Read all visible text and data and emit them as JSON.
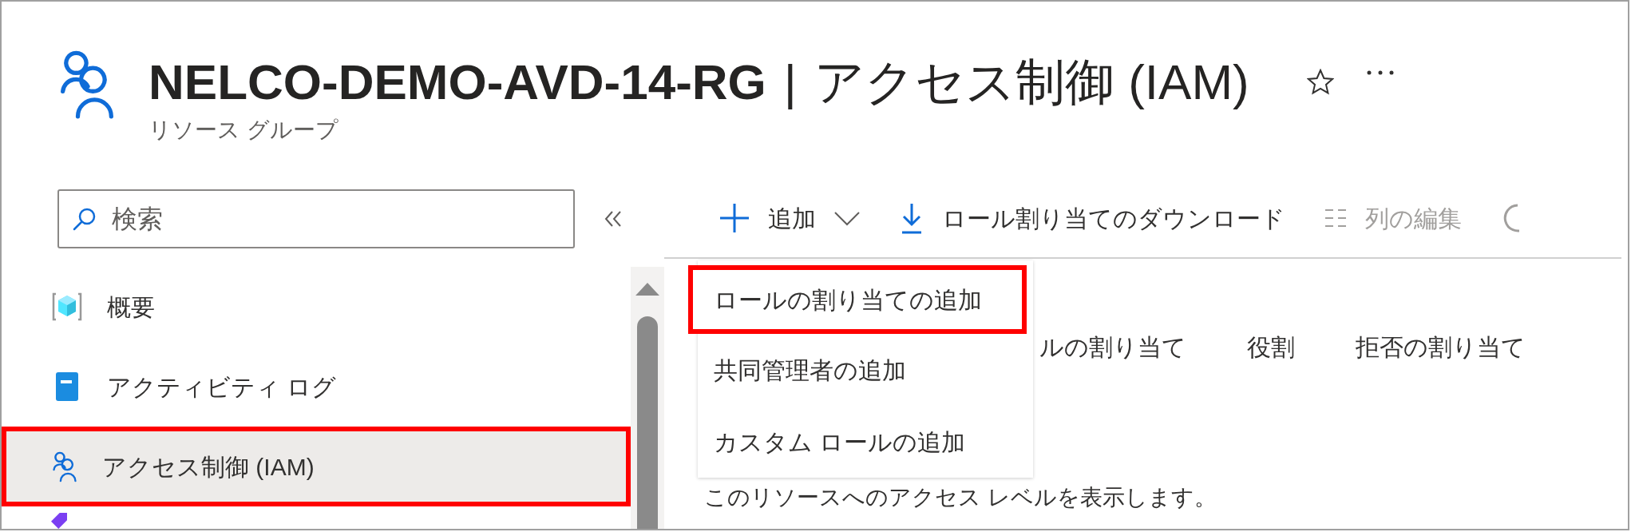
{
  "header": {
    "title": "NELCO-DEMO-AVD-14-RG",
    "separator": "|",
    "section": "アクセス制御 (IAM)",
    "subtitle": "リソース グループ"
  },
  "search": {
    "placeholder": "検索"
  },
  "sidebar": {
    "items": [
      {
        "kind": "overview",
        "label": "概要",
        "selected": false,
        "highlighted": false
      },
      {
        "kind": "log",
        "label": "アクティビティ ログ",
        "selected": false,
        "highlighted": false
      },
      {
        "kind": "iam",
        "label": "アクセス制御 (IAM)",
        "selected": true,
        "highlighted": true
      },
      {
        "kind": "tags",
        "selected": false,
        "highlighted": false
      }
    ]
  },
  "toolbar": [
    {
      "kind": "add",
      "label": "追加",
      "disabled": false
    },
    {
      "kind": "download",
      "label": "ロール割り当てのダウンロード",
      "disabled": false
    },
    {
      "kind": "columns",
      "label": "列の編集",
      "disabled": true
    },
    {
      "kind": "refresh"
    }
  ],
  "dropdown": {
    "items": [
      {
        "label": "ロールの割り当ての追加",
        "highlighted": true
      },
      {
        "label": "共同管理者の追加",
        "highlighted": false
      },
      {
        "label": "カスタム ロールの追加",
        "highlighted": false
      }
    ]
  },
  "tabs": [
    {
      "label": "ルの割り当て"
    },
    {
      "label": "役割"
    },
    {
      "label": "拒否の割り当て"
    }
  ],
  "description": "このリソースへのアクセス レベルを表示します。"
}
